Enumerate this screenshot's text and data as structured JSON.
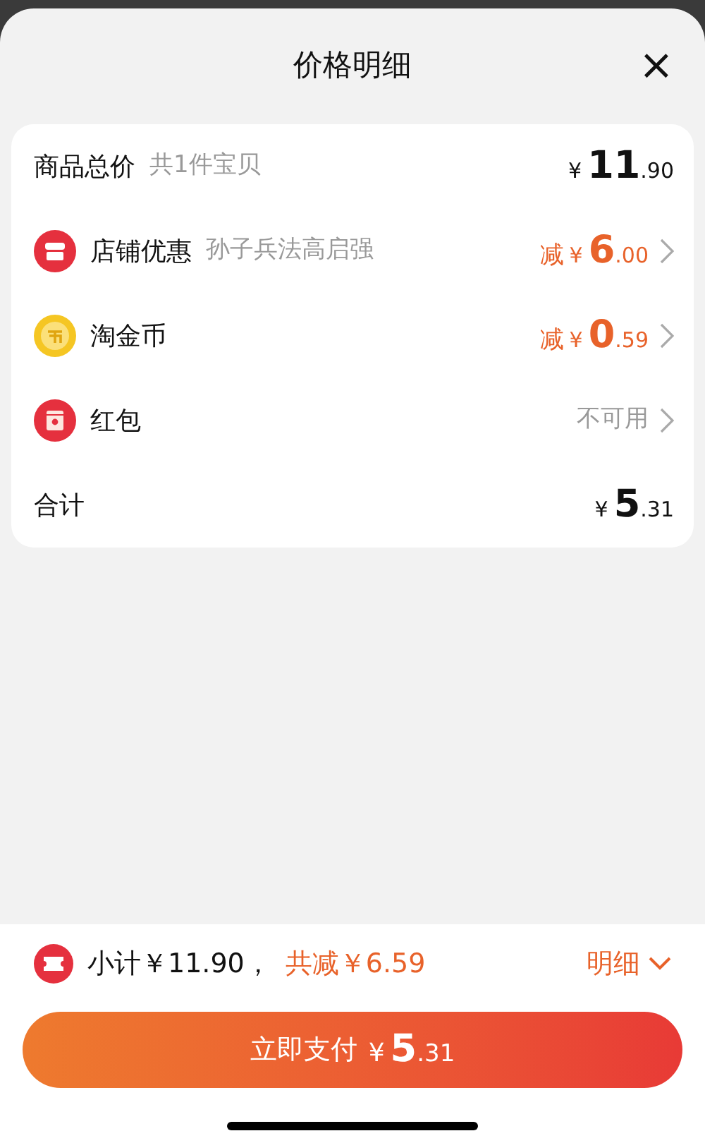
{
  "sheet": {
    "title": "价格明细",
    "close": "×"
  },
  "rows": [
    {
      "kind": "goods",
      "label": "商品总价",
      "note": "共1件宝贝",
      "price": {
        "currency": "¥",
        "integer": "11",
        "fraction": ".90"
      }
    },
    {
      "kind": "store",
      "label": "店铺优惠",
      "note": "孙子兵法高启强",
      "minus": "减",
      "price": {
        "currency": "¥",
        "integer": "6",
        "fraction": ".00"
      }
    },
    {
      "kind": "coins",
      "label": "淘金币",
      "minus": "减",
      "price": {
        "currency": "¥",
        "integer": "0",
        "fraction": ".59"
      }
    },
    {
      "kind": "packet",
      "label": "红包",
      "status": "不可用"
    },
    {
      "kind": "sum",
      "label": "合计",
      "price": {
        "currency": "¥",
        "integer": "5",
        "fraction": ".31"
      }
    }
  ],
  "footer": {
    "subtotal": "小计￥11.90，",
    "reduced": "共减￥6.59",
    "detail": "明细",
    "pay": {
      "label": "立即支付",
      "currency": "¥",
      "integer": "5",
      "fraction": ".31"
    }
  }
}
